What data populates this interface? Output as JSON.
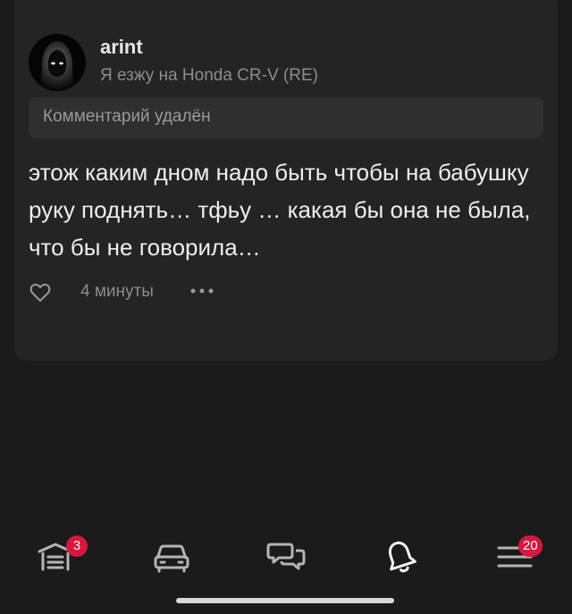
{
  "post": {
    "author": "arint",
    "subtitle": "Я езжу на Honda CR-V (RE)",
    "deleted_notice": "Комментарий удалён",
    "text": "этож каким дном надо быть чтобы на бабушку руку поднять… тфьу … какая бы она не была, что бы не говорила…",
    "time": "4 минуты"
  },
  "tabbar": {
    "items": [
      {
        "icon": "garage-icon",
        "badge": "3"
      },
      {
        "icon": "car-icon",
        "badge": ""
      },
      {
        "icon": "chat-icon",
        "badge": ""
      },
      {
        "icon": "bell-icon",
        "badge": ""
      },
      {
        "icon": "menu-icon",
        "badge": "20"
      }
    ]
  },
  "colors": {
    "background": "#1b1b1b",
    "card": "#242424",
    "badge": "#d8163e",
    "muted_text": "#8c8c8c"
  }
}
